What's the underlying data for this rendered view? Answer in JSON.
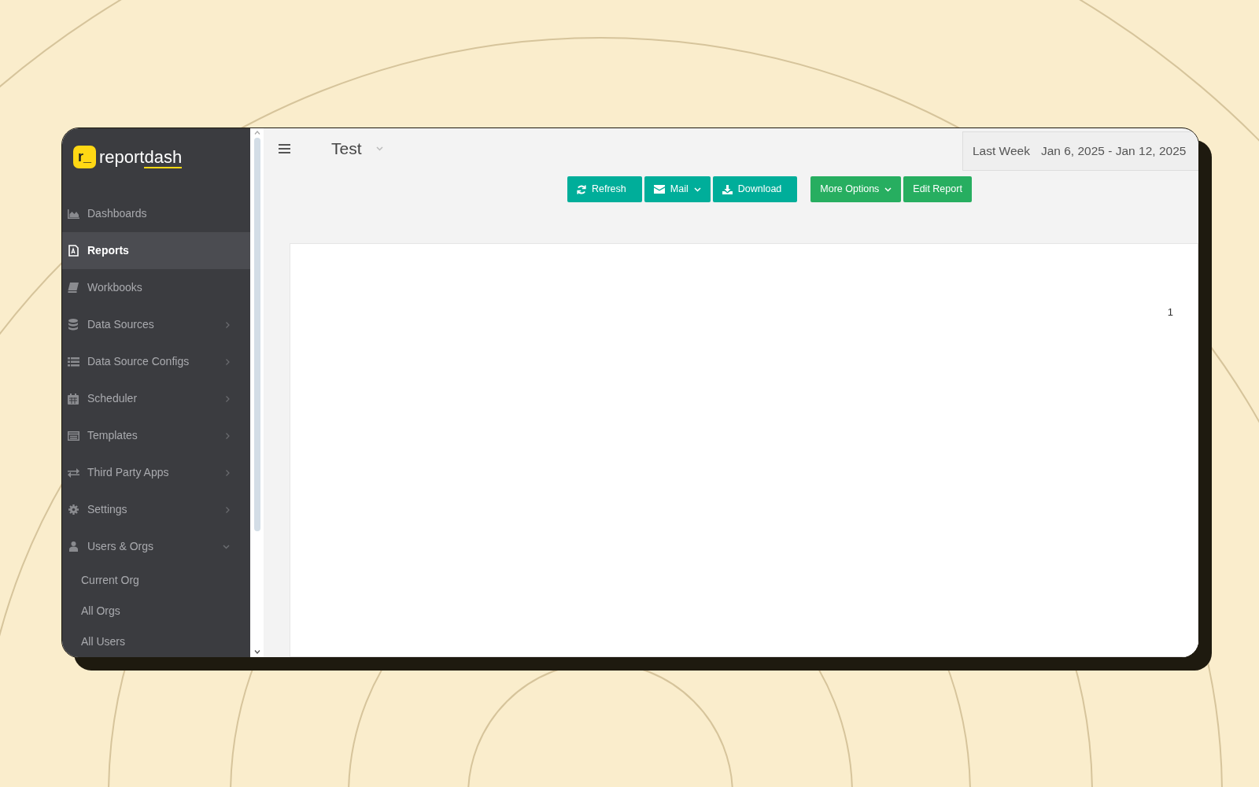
{
  "logo": {
    "mark": "r_",
    "text": "report",
    "accent": "dash"
  },
  "sidebar": {
    "items": [
      {
        "label": "Dashboards",
        "selected": false,
        "submenu": false
      },
      {
        "label": "Reports",
        "selected": true,
        "submenu": false
      },
      {
        "label": "Workbooks",
        "selected": false,
        "submenu": false
      },
      {
        "label": "Data Sources",
        "selected": false,
        "submenu": true
      },
      {
        "label": "Data Source Configs",
        "selected": false,
        "submenu": true
      },
      {
        "label": "Scheduler",
        "selected": false,
        "submenu": true
      },
      {
        "label": "Templates",
        "selected": false,
        "submenu": true
      },
      {
        "label": "Third Party Apps",
        "selected": false,
        "submenu": true
      },
      {
        "label": "Settings",
        "selected": false,
        "submenu": true
      },
      {
        "label": "Users & Orgs",
        "selected": false,
        "submenu": true,
        "expanded": true,
        "children": [
          {
            "label": "Current Org",
            "selected": false
          },
          {
            "label": "All Orgs",
            "selected": false
          },
          {
            "label": "All Users",
            "selected": false
          }
        ]
      }
    ]
  },
  "header": {
    "title": "Test",
    "date_range": {
      "preset": "Last Week",
      "range": "Jan 6, 2025 - Jan 12, 2025"
    }
  },
  "toolbar": [
    {
      "label": "Refresh",
      "kind": "primary",
      "dropdown": false
    },
    {
      "label": "Mail",
      "kind": "primary",
      "dropdown": true
    },
    {
      "label": "Download",
      "kind": "primary",
      "dropdown": false
    },
    {
      "label": "More Options",
      "kind": "success",
      "dropdown": true
    },
    {
      "label": "Edit Report",
      "kind": "success",
      "dropdown": false
    }
  ],
  "report": {
    "page_number": "1"
  }
}
